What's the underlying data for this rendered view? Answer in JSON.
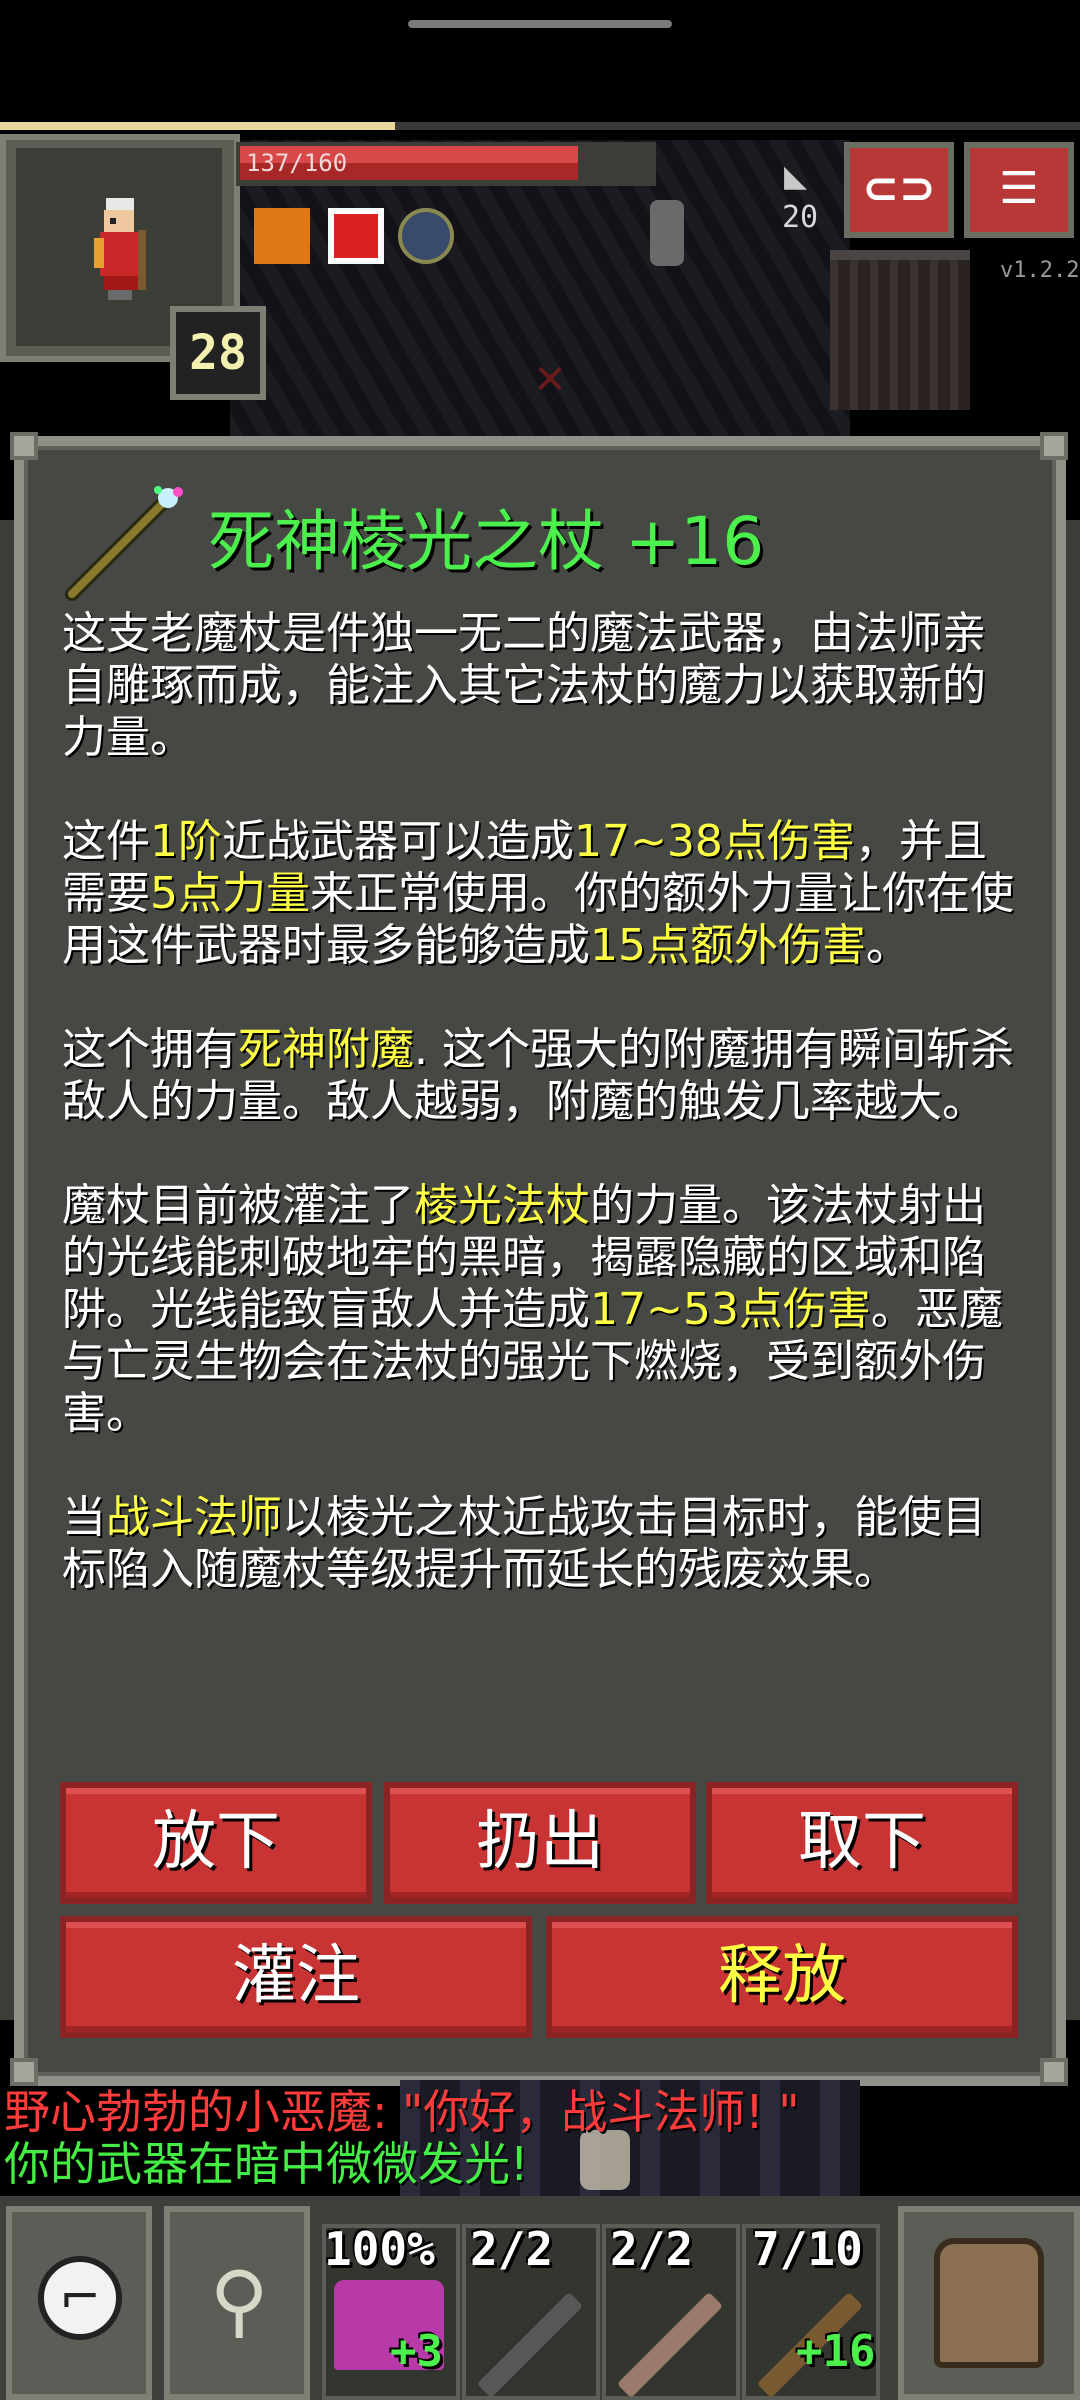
{
  "hud": {
    "hp_text": "137/160",
    "hp_fraction": 0.856,
    "level": "28",
    "depth": "20",
    "version": "v1.2.2",
    "xp_fraction": 0.365,
    "buff_icons": [
      "orange-buff-icon",
      "red-cross-buff-icon",
      "blue-orb-buff-icon"
    ],
    "top_buttons": [
      "journal-icon",
      "menu-icon"
    ]
  },
  "item_window": {
    "title": "死神棱光之杖 +16",
    "paragraphs": [
      [
        {
          "t": "这支老魔杖是件独一无二的魔法武器，由法师亲自雕琢而成，能注入其它法杖的魔力以获取新的力量。",
          "hl": false
        }
      ],
      [
        {
          "t": "这件",
          "hl": false
        },
        {
          "t": "1阶",
          "hl": true
        },
        {
          "t": "近战武器可以造成",
          "hl": false
        },
        {
          "t": "17~38点伤害",
          "hl": true
        },
        {
          "t": "，并且需要",
          "hl": false
        },
        {
          "t": "5点力量",
          "hl": true
        },
        {
          "t": "来正常使用。你的额外力量让你在使用这件武器时最多能够造成",
          "hl": false
        },
        {
          "t": "15点额外伤害",
          "hl": true
        },
        {
          "t": "。",
          "hl": false
        }
      ],
      [
        {
          "t": "这个拥有",
          "hl": false
        },
        {
          "t": "死神附魔",
          "hl": true
        },
        {
          "t": ". 这个强大的附魔拥有瞬间斩杀敌人的力量。敌人越弱，附魔的触发几率越大。",
          "hl": false
        }
      ],
      [
        {
          "t": "魔杖目前被灌注了",
          "hl": false
        },
        {
          "t": "棱光法杖",
          "hl": true
        },
        {
          "t": "的力量。该法杖射出的光线能刺破地牢的黑暗，揭露隐藏的区域和陷阱。光线能致盲敌人并造成",
          "hl": false
        },
        {
          "t": "17~53点伤害",
          "hl": true
        },
        {
          "t": "。恶魔与亡灵生物会在法杖的强光下燃烧，受到额外伤害。",
          "hl": false
        }
      ],
      [
        {
          "t": "当",
          "hl": false
        },
        {
          "t": "战斗法师",
          "hl": true
        },
        {
          "t": "以棱光之杖近战攻击目标时，能使目标陷入随魔杖等级提升而延长的残废效果。",
          "hl": false
        }
      ]
    ],
    "buttons": {
      "drop": "放下",
      "throw": "扔出",
      "unequip": "取下",
      "imbue": "灌注",
      "release": "释放"
    }
  },
  "log": {
    "line1": "野心勃勃的小恶魔: \"你好，战斗法师! \"",
    "line2": "你的武器在暗中微微发光!"
  },
  "quickslots": [
    {
      "label": "100%",
      "upgrade": "+3",
      "icon": "cloth-armor-icon"
    },
    {
      "label": "2/2",
      "upgrade": "",
      "icon": "wand-icon"
    },
    {
      "label": "2/2",
      "upgrade": "",
      "icon": "wand-icon"
    },
    {
      "label": "7/10",
      "upgrade": "+16",
      "icon": "mage-staff-icon"
    }
  ],
  "colors": {
    "title": "#4cf04c",
    "highlight": "#ffff44",
    "button": "#c83434",
    "window": "#454843",
    "log_red": "#ff3c3c",
    "log_green": "#44ee44"
  }
}
